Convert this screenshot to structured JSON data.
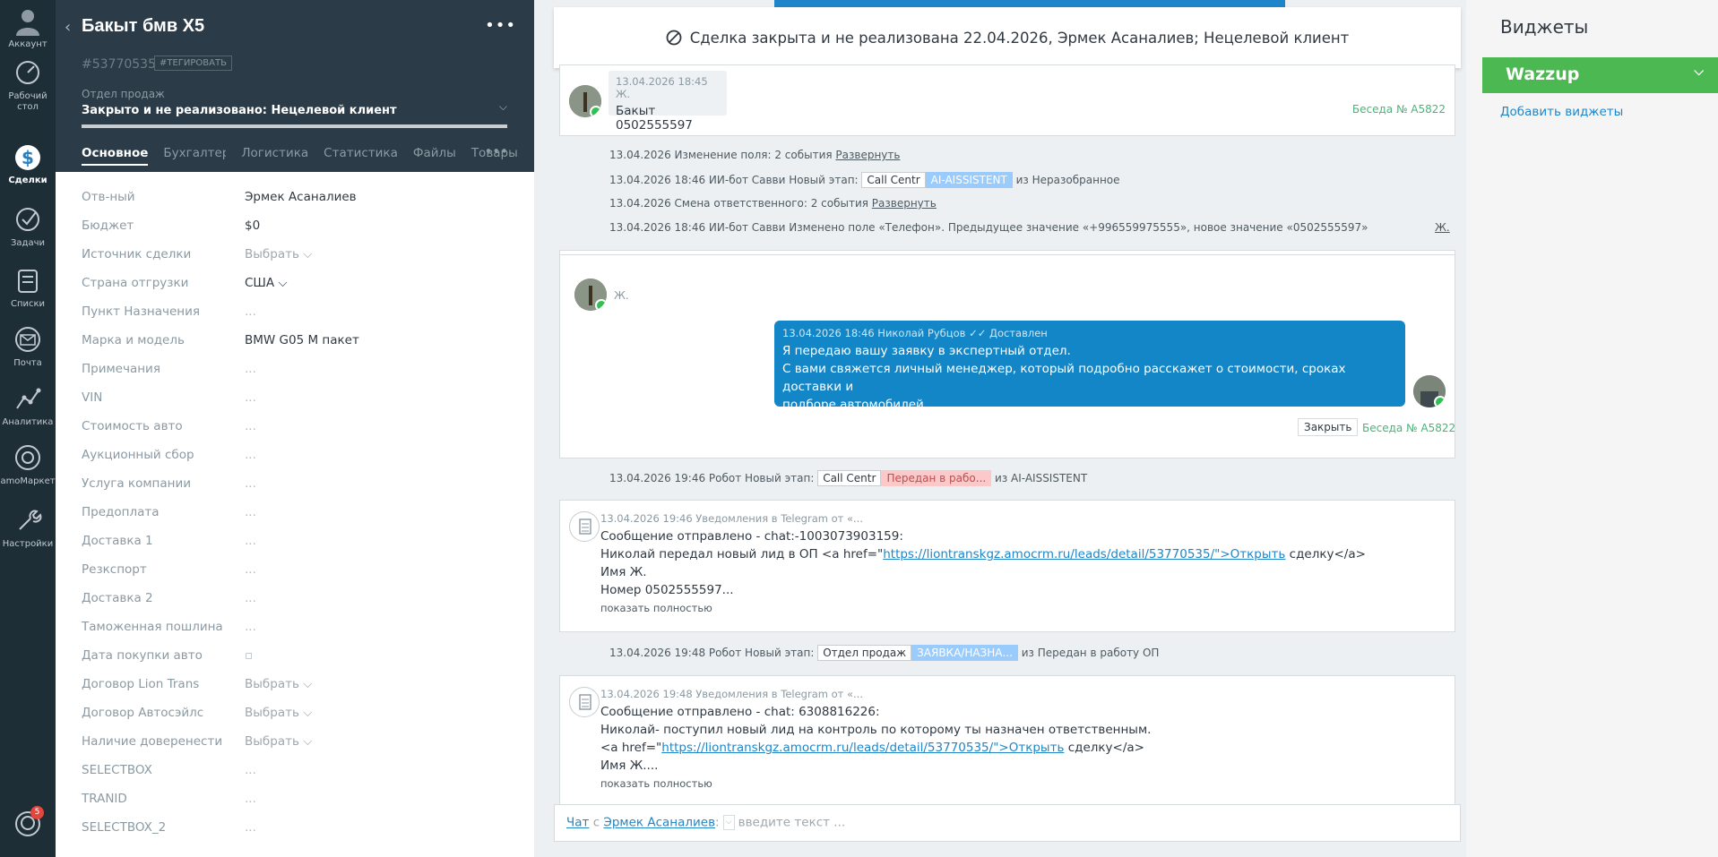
{
  "nav": {
    "items": [
      {
        "label": "Аккаунт",
        "icon": "account-icon"
      },
      {
        "label": "Рабочий стол",
        "icon": "dashboard-icon"
      },
      {
        "label": "Сделки",
        "icon": "deals-icon"
      },
      {
        "label": "Задачи",
        "icon": "tasks-icon"
      },
      {
        "label": "Списки",
        "icon": "lists-icon"
      },
      {
        "label": "Почта",
        "icon": "mail-icon"
      },
      {
        "label": "Аналитика",
        "icon": "analytics-icon"
      },
      {
        "label": "amoМаркет",
        "icon": "market-icon"
      },
      {
        "label": "Настройки",
        "icon": "settings-icon"
      }
    ],
    "chat_badge": "5"
  },
  "card": {
    "title": "Бакыт бмв Х5",
    "id": "#53770535",
    "tag_button": "#ТЕГИРОВАТЬ",
    "pipeline": "Отдел продаж",
    "status": "Закрыто и не реализовано: Нецелевой клиент",
    "tabs": [
      "Основное",
      "Бухгалтер",
      "Логистика",
      "Статистика",
      "Файлы",
      "Товары"
    ],
    "fields": [
      {
        "label": "Отв-ный",
        "value": "Эрмек Асаналиев"
      },
      {
        "label": "Бюджет",
        "value": "$0"
      },
      {
        "label": "Источник сделки",
        "value": "Выбрать ⌵"
      },
      {
        "label": "Страна отгрузки",
        "value": "США ⌵"
      },
      {
        "label": "Пункт Назначения",
        "value": "..."
      },
      {
        "label": "Марка и модель",
        "value": "BMW G05 M пакет"
      },
      {
        "label": "Примечания",
        "value": "..."
      },
      {
        "label": "VIN",
        "value": "..."
      },
      {
        "label": "Стоимость авто",
        "value": "..."
      },
      {
        "label": "Аукционный сбор",
        "value": "..."
      },
      {
        "label": "Услуга компании",
        "value": "..."
      },
      {
        "label": "Предоплата",
        "value": "..."
      },
      {
        "label": "Доставка 1",
        "value": "..."
      },
      {
        "label": "Резкспорт",
        "value": "..."
      },
      {
        "label": "Доставка 2",
        "value": "..."
      },
      {
        "label": "Таможенная пошлина",
        "value": "..."
      },
      {
        "label": "Дата покупки авто",
        "value": "▫"
      },
      {
        "label": "Договор Lion Trans",
        "value": "Выбрать ⌵"
      },
      {
        "label": "Договор Автосэйлс",
        "value": "Выбрать ⌵"
      },
      {
        "label": "Наличие доверенести",
        "value": "Выбрать ⌵"
      },
      {
        "label": "SELECTBOX",
        "value": "..."
      },
      {
        "label": "TRANID",
        "value": "..."
      },
      {
        "label": "SELECTBOX_2",
        "value": "..."
      }
    ]
  },
  "feed": {
    "closed_banner": "Сделка закрыта и не реализована 22.04.2026, Эрмек Асаналиев; Нецелевой клиент",
    "msg1": {
      "meta": "13.04.2026 18:45 Ж.",
      "text": "Бакыт 0502555597",
      "conv": "Беседа № A5822"
    },
    "events1": [
      {
        "text": "13.04.2026 Изменение поля: 2 события ",
        "link": "Развернуть"
      },
      {
        "prefix": "13.04.2026 18:46 ИИ-бот Савви Новый этап: ",
        "pill1": "Call Centr",
        "pill2": "AI-AISSISTENT",
        "suffix": " из Неразобранное"
      },
      {
        "text": "13.04.2026 Смена ответственного: 2 события ",
        "link": "Развернуть"
      },
      {
        "text": "13.04.2026 18:46 ИИ-бот Савви Изменено поле «Телефон». Предыдущее значение «+996559975555», новое значение «0502555597»",
        "right": "Ж."
      }
    ],
    "msg2": {
      "client": "Ж.",
      "meta": "13.04.2026 18:46 Николай Рубцов",
      "delivered": "✓✓ Доставлен",
      "lines": [
        "Я передаю вашу заявку в экспертный отдел.",
        "С вами свяжется личный менеджер, который подробно расскажет о стоимости, сроках доставки и",
        "подборе автомобилей."
      ],
      "close_btn": "Закрыть",
      "conv": "Беседа № A5822"
    },
    "event2": {
      "prefix": "13.04.2026 19:46 Робот Новый этап: ",
      "pill1": "Call Centr",
      "pill2": "Передан в рабо...",
      "suffix": " из AI-AISSISTENT"
    },
    "tg1": {
      "meta": "13.04.2026 19:46 Уведомления в Telegram от «...",
      "line1": "Сообщение отправлено - chat:-1003073903159:",
      "line2_pre": "Николай передал новый лид в ОП <a href=\"",
      "line2_link": "https://liontranskgz.amocrm.ru/leads/detail/53770535/\">Открыть",
      "line2_post": " сделку</a>",
      "line3": "Имя Ж.",
      "line4": "Номер 0502555597...",
      "more": "показать полностью"
    },
    "event3": {
      "prefix": "13.04.2026 19:48 Робот Новый этап: ",
      "pill1": "Отдел продаж",
      "pill2": "ЗАЯВКА/НАЗНА...",
      "suffix": " из Передан в работу ОП"
    },
    "tg2": {
      "meta": "13.04.2026 19:48 Уведомления в Telegram от «...",
      "line1": "Сообщение отправлено - chat: 6308816226:",
      "line2": "Николай- поступил новый лид на контроль по которому ты назначен ответственным.",
      "line3_pre": "<a href=\"",
      "line3_link": "https://liontranskgz.amocrm.ru/leads/detail/53770535/\">Открыть",
      "line3_post": " сделку</a>",
      "line4": "Имя Ж....",
      "more": "показать полностью"
    },
    "chat_bar": {
      "chat": "Чат",
      "with": " с ",
      "person": "Эрмек Асаналиев",
      "sep": ":",
      "placeholder": "введите текст ..."
    }
  },
  "widgets": {
    "title": "Виджеты",
    "wazzup": "Wazzup",
    "add": "Добавить виджеты"
  }
}
